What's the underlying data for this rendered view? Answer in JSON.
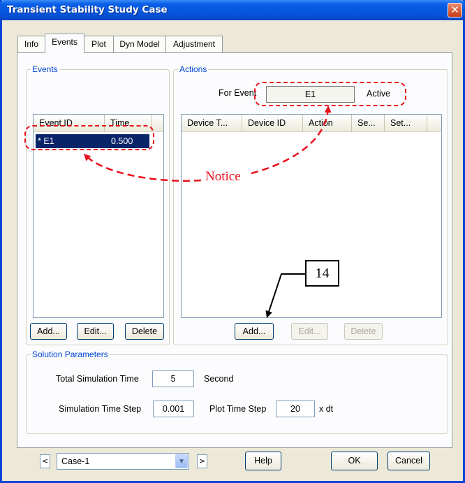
{
  "window": {
    "title": "Transient Stability Study Case"
  },
  "tabs": [
    {
      "label": "Info",
      "active": false
    },
    {
      "label": "Events",
      "active": true
    },
    {
      "label": "Plot",
      "active": false
    },
    {
      "label": "Dyn Model",
      "active": false
    },
    {
      "label": "Adjustment",
      "active": false
    }
  ],
  "events": {
    "group_label": "Events",
    "columns": [
      "Event ID",
      "Time"
    ],
    "rows": [
      {
        "id": "* E1",
        "time": "0.500",
        "selected": true
      }
    ],
    "buttons": {
      "add": "Add...",
      "edit": "Edit...",
      "delete": "Delete"
    }
  },
  "actions": {
    "group_label": "Actions",
    "for_event_label": "For Event",
    "for_event_value": "E1",
    "status": "Active",
    "columns": [
      "Device T...",
      "Device ID",
      "Action",
      "Se...",
      "Set..."
    ],
    "buttons": {
      "add": "Add...",
      "edit": "Edit...",
      "delete": "Delete"
    }
  },
  "solution": {
    "group_label": "Solution Parameters",
    "total_time_label": "Total Simulation Time",
    "total_time_value": "5",
    "total_time_unit": "Second",
    "time_step_label": "Simulation Time Step",
    "time_step_value": "0.001",
    "plot_step_label": "Plot Time Step",
    "plot_step_value": "20",
    "plot_step_unit": "x dt"
  },
  "footer": {
    "prev_icon": "<",
    "next_icon": ">",
    "case_value": "Case-1",
    "help": "Help",
    "ok": "OK",
    "cancel": "Cancel"
  },
  "annotations": {
    "notice": "Notice",
    "callout": "14",
    "color": "#e8101b"
  }
}
